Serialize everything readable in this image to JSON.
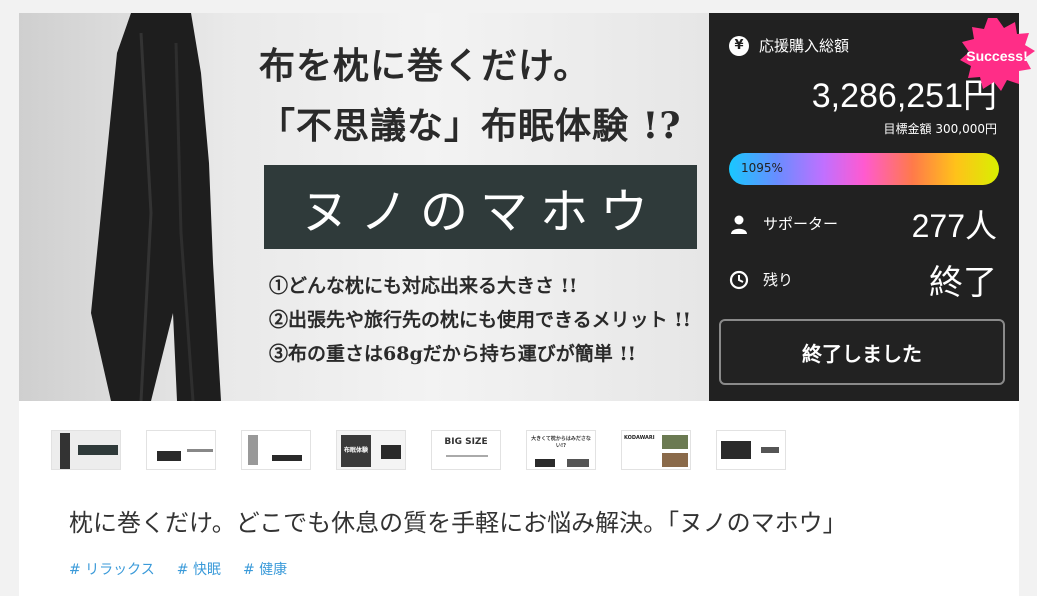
{
  "hero": {
    "line1": "布を枕に巻くだけ。",
    "line2": "「不思議な」布眠体験 !?",
    "brand": "ヌノのマホウ",
    "bullets": [
      "①どんな枕にも対応出来る大きさ !!",
      "②出張先や旅行先の枕にも使用できるメリット !!",
      "③布の重さは68gだから持ち運びが簡単 !!"
    ]
  },
  "panel": {
    "total_label": "応援購入総額",
    "total_value": "3,286,251円",
    "goal_text": "目標金額 300,000円",
    "progress_percent_label": "1095%",
    "progress_percent": 1095,
    "supporters_label": "サポーター",
    "supporters_value": "277人",
    "remaining_label": "残り",
    "remaining_value": "終了",
    "button_label": "終了しました"
  },
  "badge": {
    "text": "Success!",
    "color": "#ff2d87"
  },
  "thumbnails": {
    "t5_label": "BIG SIZE",
    "t4_label": "布眠体験",
    "t6_label": "大きくて枕からはみださない!?",
    "t7_label": "KODAWARI"
  },
  "project": {
    "title": "枕に巻くだけ。どこでも休息の質を手軽にお悩み解決。「ヌノのマホウ」",
    "tags": [
      "# リラックス",
      "# 快眠",
      "# 健康"
    ]
  },
  "icons": {
    "yen": "yen-icon",
    "user": "user-icon",
    "clock": "clock-icon"
  },
  "colors": {
    "panel_bg": "#212121",
    "tag": "#3a9ad9",
    "brand_box": "#2f3a3a"
  }
}
